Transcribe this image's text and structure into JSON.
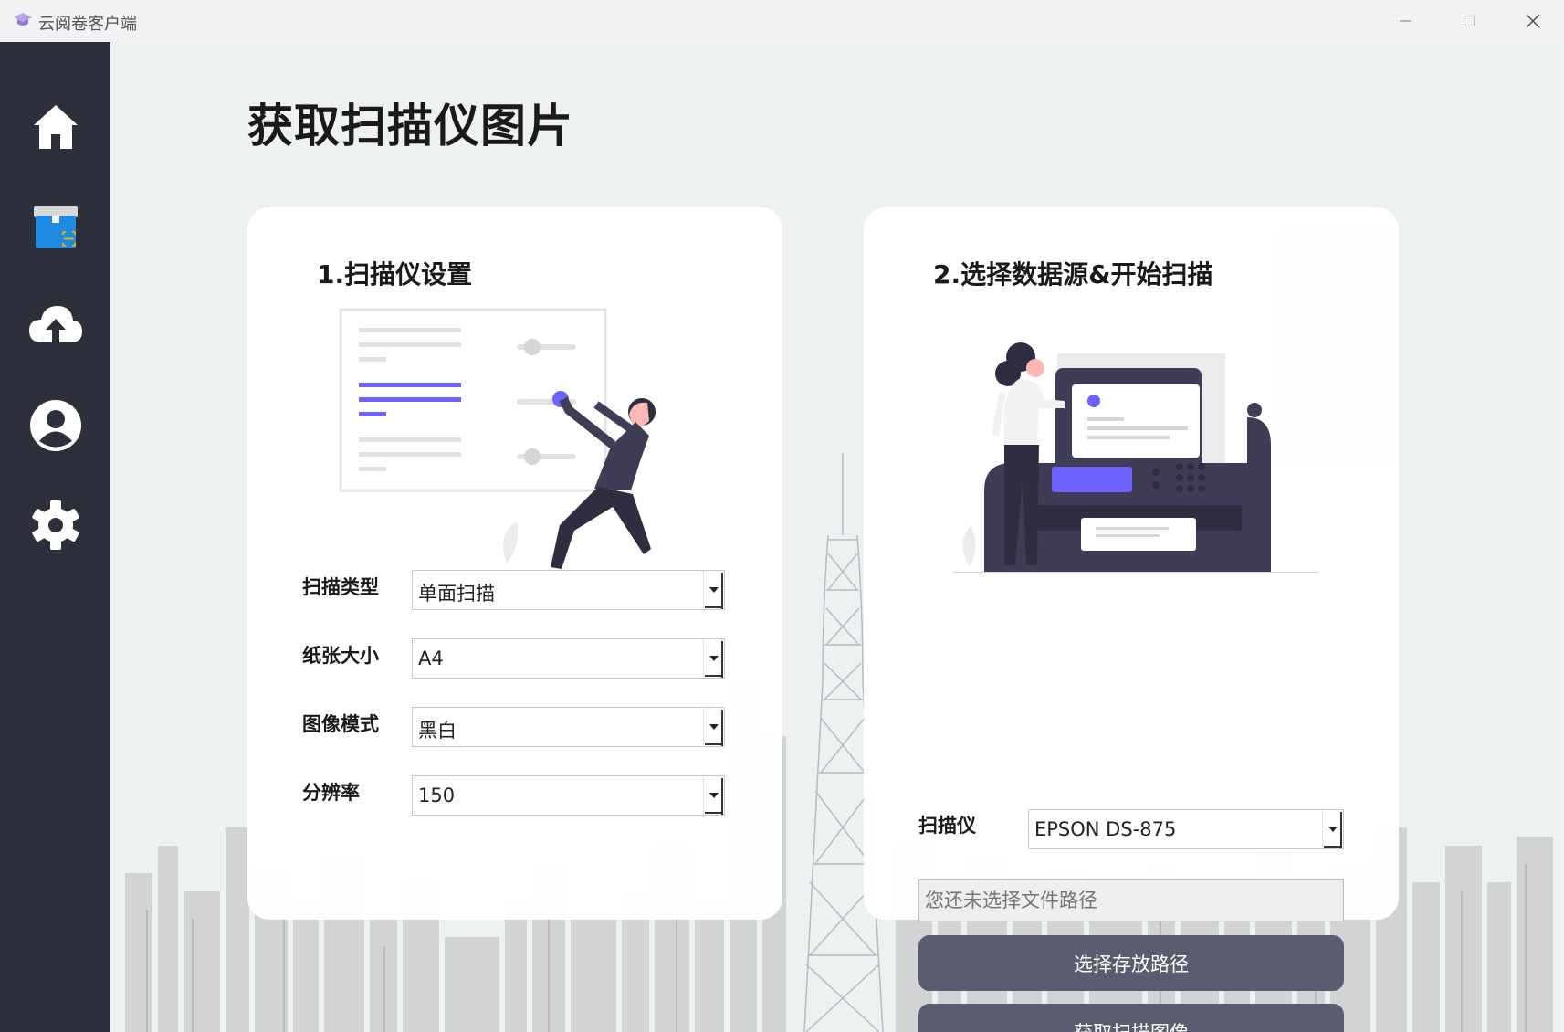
{
  "window": {
    "title": "云阅卷客户端",
    "min": "—",
    "max": "☐",
    "close": "✕"
  },
  "sidebar": {
    "items": [
      {
        "name": "home",
        "icon": "home-icon"
      },
      {
        "name": "scan",
        "icon": "scan-box-icon"
      },
      {
        "name": "upload",
        "icon": "cloud-upload-icon"
      },
      {
        "name": "account",
        "icon": "user-icon"
      },
      {
        "name": "settings",
        "icon": "gear-icon"
      }
    ]
  },
  "page": {
    "title": "获取扫描仪图片"
  },
  "scanner_settings": {
    "title": "1.扫描仪设置",
    "fields": [
      {
        "label": "扫描类型",
        "value": "单面扫描"
      },
      {
        "label": "纸张大小",
        "value": "A4"
      },
      {
        "label": "图像模式",
        "value": "黑白"
      },
      {
        "label": "分辨率",
        "value": "150"
      }
    ]
  },
  "scan_source": {
    "title": "2.选择数据源&开始扫描",
    "scanner_label": "扫描仪",
    "scanner_value": "EPSON DS-875",
    "path_placeholder": "您还未选择文件路径",
    "choose_path_label": "选择存放路径",
    "get_image_label": "获取扫描图像"
  },
  "colors": {
    "sidebar": "#2d303a",
    "accent": "#6c63ff",
    "button": "#5a5d70",
    "background": "#eef1f2"
  }
}
